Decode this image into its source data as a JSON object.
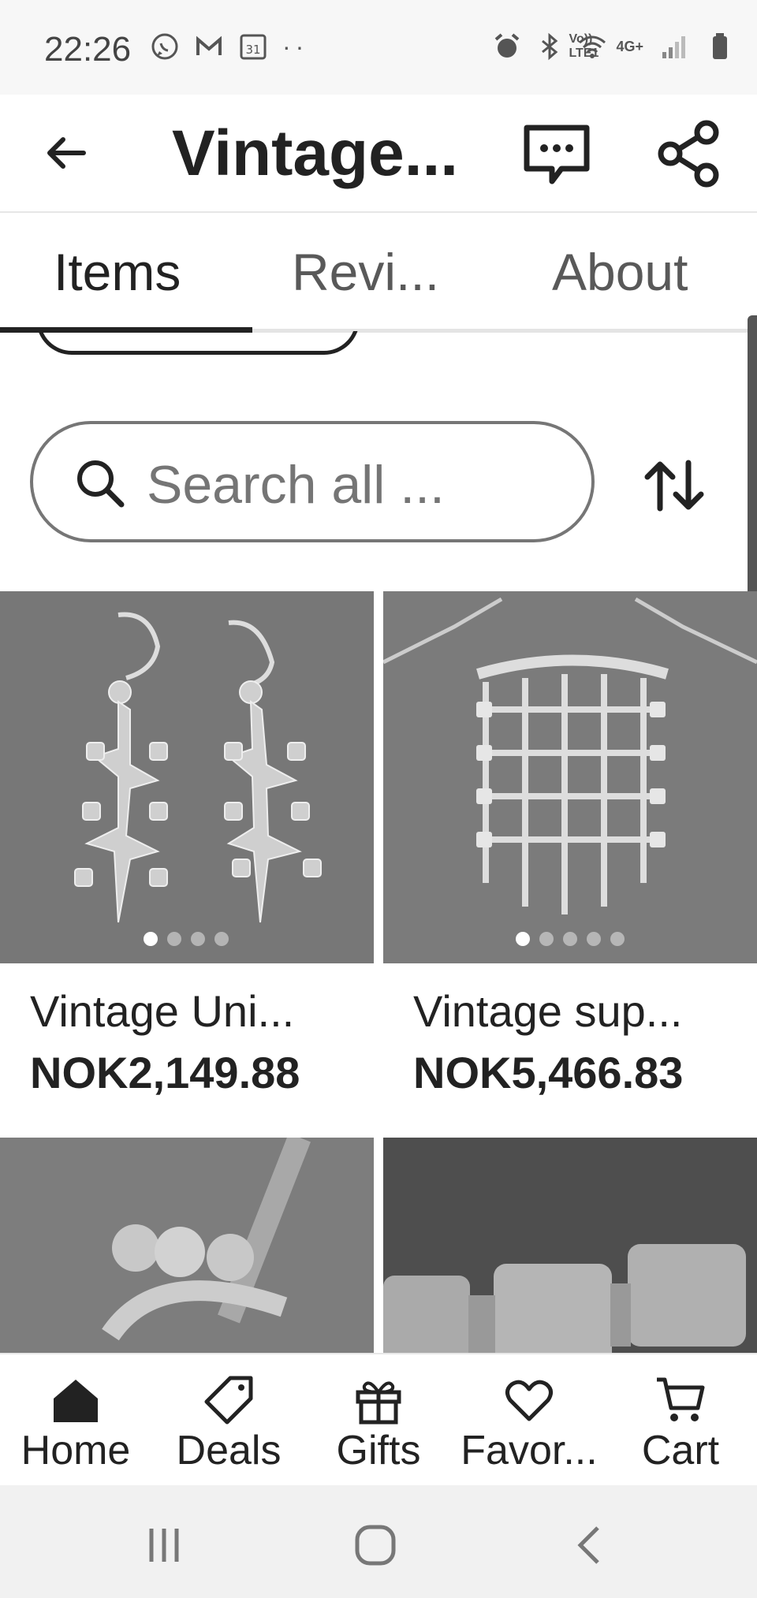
{
  "status_bar": {
    "time": "22:26",
    "left_icons": [
      "whatsapp-icon",
      "gmail-icon",
      "calendar-icon"
    ],
    "calendar_day": "31",
    "more": "··",
    "right_icons": [
      "alarm-icon",
      "bluetooth-icon",
      "wifi-icon",
      "volte-icon",
      "4g-icon",
      "signal-icon",
      "battery-icon"
    ],
    "volte_text": "Vo)) LTE1",
    "network_text": "4G+"
  },
  "header": {
    "title": "Vintage..."
  },
  "tabs": [
    {
      "label": "Items",
      "active": true
    },
    {
      "label": "Revi...",
      "active": false
    },
    {
      "label": "About",
      "active": false
    }
  ],
  "search": {
    "placeholder": "Search all ..."
  },
  "listings": [
    {
      "title": "Vintage Uni...",
      "price": "NOK2,149.88",
      "image_dots": 4,
      "active_dot": 0
    },
    {
      "title": "Vintage sup...",
      "price": "NOK5,466.83",
      "image_dots": 5,
      "active_dot": 0
    },
    {
      "title": "",
      "price": ""
    },
    {
      "title": "",
      "price": ""
    }
  ],
  "bottom_nav": [
    {
      "label": "Home",
      "icon": "home-icon",
      "active": true
    },
    {
      "label": "Deals",
      "icon": "tag-icon",
      "active": false
    },
    {
      "label": "Gifts",
      "icon": "gift-icon",
      "active": false
    },
    {
      "label": "Favor...",
      "icon": "heart-icon",
      "active": false
    },
    {
      "label": "Cart",
      "icon": "cart-icon",
      "active": false
    }
  ],
  "system_nav": [
    "recents-icon",
    "home-circle-icon",
    "back-chevron-icon"
  ],
  "colors": {
    "text": "#222222",
    "muted": "#595959",
    "image_bg": "#7a7a7a",
    "accent_dark": "#222222"
  }
}
